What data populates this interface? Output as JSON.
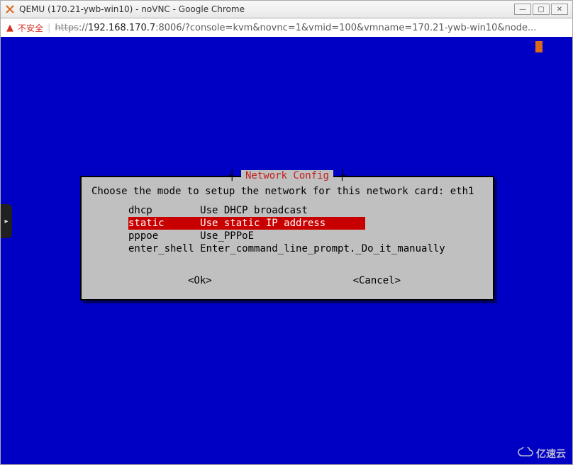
{
  "window": {
    "title": "QEMU (170.21-ywb-win10) - noVNC - Google Chrome"
  },
  "address": {
    "not_secure": "不安全",
    "scheme": "https",
    "sep": "://",
    "host": "192.168.170.7",
    "rest": ":8006/?console=kvm&novnc=1&vmid=100&vmname=170.21-ywb-win10&node...",
    "separator": " | "
  },
  "dialog": {
    "title_left": "┤ ",
    "title": "Network Config",
    "title_right": " ├",
    "prompt": "Choose the mode to setup the network for this network card: eth1",
    "options": [
      {
        "key": "dhcp       ",
        "desc": "Use DHCP broadcast",
        "selected": false
      },
      {
        "key": "static     ",
        "desc": "Use static IP address",
        "selected": true
      },
      {
        "key": "pppoe      ",
        "desc": "Use_PPPoE",
        "selected": false
      },
      {
        "key": "enter_shell",
        "desc": "Enter_command_line_prompt._Do_it_manually",
        "selected": false
      }
    ],
    "ok": "<Ok>",
    "cancel": "<Cancel>"
  },
  "watermark": "亿速云",
  "sidetab_glyph": "▸"
}
